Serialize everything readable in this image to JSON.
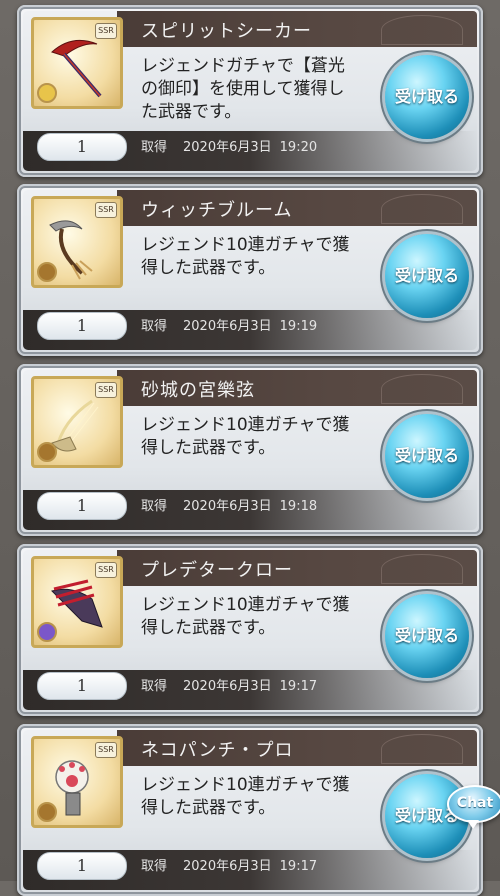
{
  "items": [
    {
      "name": "スピリットシーカー",
      "desc_line1": "レジェンドガチャで【蒼光",
      "desc_line2": "の御印】を使用して獲得し",
      "desc_line3": "た武器です。",
      "quantity": "1",
      "acquired_label": "取得",
      "date": "2020年6月3日",
      "time": "19:20",
      "receive_label": "受け取る",
      "rarity_badge": "SSR",
      "weapon_icon": "scythe-icon",
      "element_color": "#e8c44a"
    },
    {
      "name": "ウィッチブルーム",
      "desc_line1": "レジェンド10連ガチャで獲",
      "desc_line2": "得した武器です。",
      "desc_line3": "",
      "quantity": "1",
      "acquired_label": "取得",
      "date": "2020年6月3日",
      "time": "19:19",
      "receive_label": "受け取る",
      "rarity_badge": "SSR",
      "weapon_icon": "broom-scythe-icon",
      "element_color": "#a5762e"
    },
    {
      "name": "砂城の宮樂弦",
      "desc_line1": "レジェンド10連ガチャで獲",
      "desc_line2": "得した武器です。",
      "desc_line3": "",
      "quantity": "1",
      "acquired_label": "取得",
      "date": "2020年6月3日",
      "time": "19:18",
      "receive_label": "受け取る",
      "rarity_badge": "SSR",
      "weapon_icon": "harp-icon",
      "element_color": "#a5762e"
    },
    {
      "name": "プレデタークロー",
      "desc_line1": "レジェンド10連ガチャで獲",
      "desc_line2": "得した武器です。",
      "desc_line3": "",
      "quantity": "1",
      "acquired_label": "取得",
      "date": "2020年6月3日",
      "time": "19:17",
      "receive_label": "受け取る",
      "rarity_badge": "SSR",
      "weapon_icon": "claw-icon",
      "element_color": "#7b57c9"
    },
    {
      "name": "ネコパンチ・プロ",
      "desc_line1": "レジェンド10連ガチャで獲",
      "desc_line2": "得した武器です。",
      "desc_line3": "",
      "quantity": "1",
      "acquired_label": "取得",
      "date": "2020年6月3日",
      "time": "19:17",
      "receive_label": "受け取る",
      "rarity_badge": "SSR",
      "weapon_icon": "cat-paw-glove-icon",
      "element_color": "#a5762e"
    }
  ],
  "chat_button": {
    "label": "Chat"
  }
}
